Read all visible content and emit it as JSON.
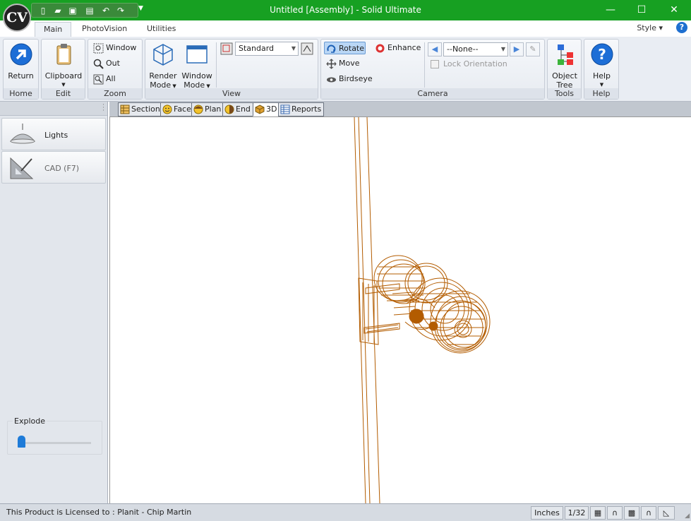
{
  "window": {
    "logo_text": "CV",
    "title": "Untitled [Assembly] - Solid Ultimate",
    "minimize": "—",
    "maximize": "☐",
    "close": "✕"
  },
  "ribbon_tabs": [
    "Main",
    "PhotoVision",
    "Utilities"
  ],
  "style_menu": "Style",
  "help_glyph": "?",
  "groups": {
    "home": {
      "label": "Home",
      "return_label": "Return"
    },
    "edit": {
      "label": "Edit",
      "clipboard_label": "Clipboard"
    },
    "zoom": {
      "label": "Zoom",
      "window_label": "Window",
      "out_label": "Out",
      "all_label": "All"
    },
    "view": {
      "label": "View",
      "render_mode_1": "Render",
      "render_mode_2": "Mode",
      "window_mode_1": "Window",
      "window_mode_2": "Mode",
      "view_select": "Standard"
    },
    "camera": {
      "label": "Camera",
      "rotate_label": "Rotate",
      "enhance_label": "Enhance",
      "move_label": "Move",
      "birdseye_label": "Birdseye",
      "camera_select": "--None--",
      "lock_orientation_label": "Lock Orientation"
    },
    "tools": {
      "label": "Tools",
      "object_tree_1": "Object",
      "object_tree_2": "Tree"
    },
    "help": {
      "label": "Help",
      "help_label": "Help"
    }
  },
  "sidebar": {
    "lights_label": "Lights",
    "cad_label": "CAD (F7)",
    "explode_label": "Explode",
    "explode_value": 0
  },
  "view_tabs": [
    "Section",
    "Face",
    "Plan",
    "End",
    "3D",
    "Reports"
  ],
  "status": {
    "license_text": "This Product is Licensed to : Planit - Chip Martin",
    "units": "Inches",
    "precision": "1/32"
  },
  "colors": {
    "titlebar": "#17a022",
    "wireframe": "#b35c00"
  }
}
